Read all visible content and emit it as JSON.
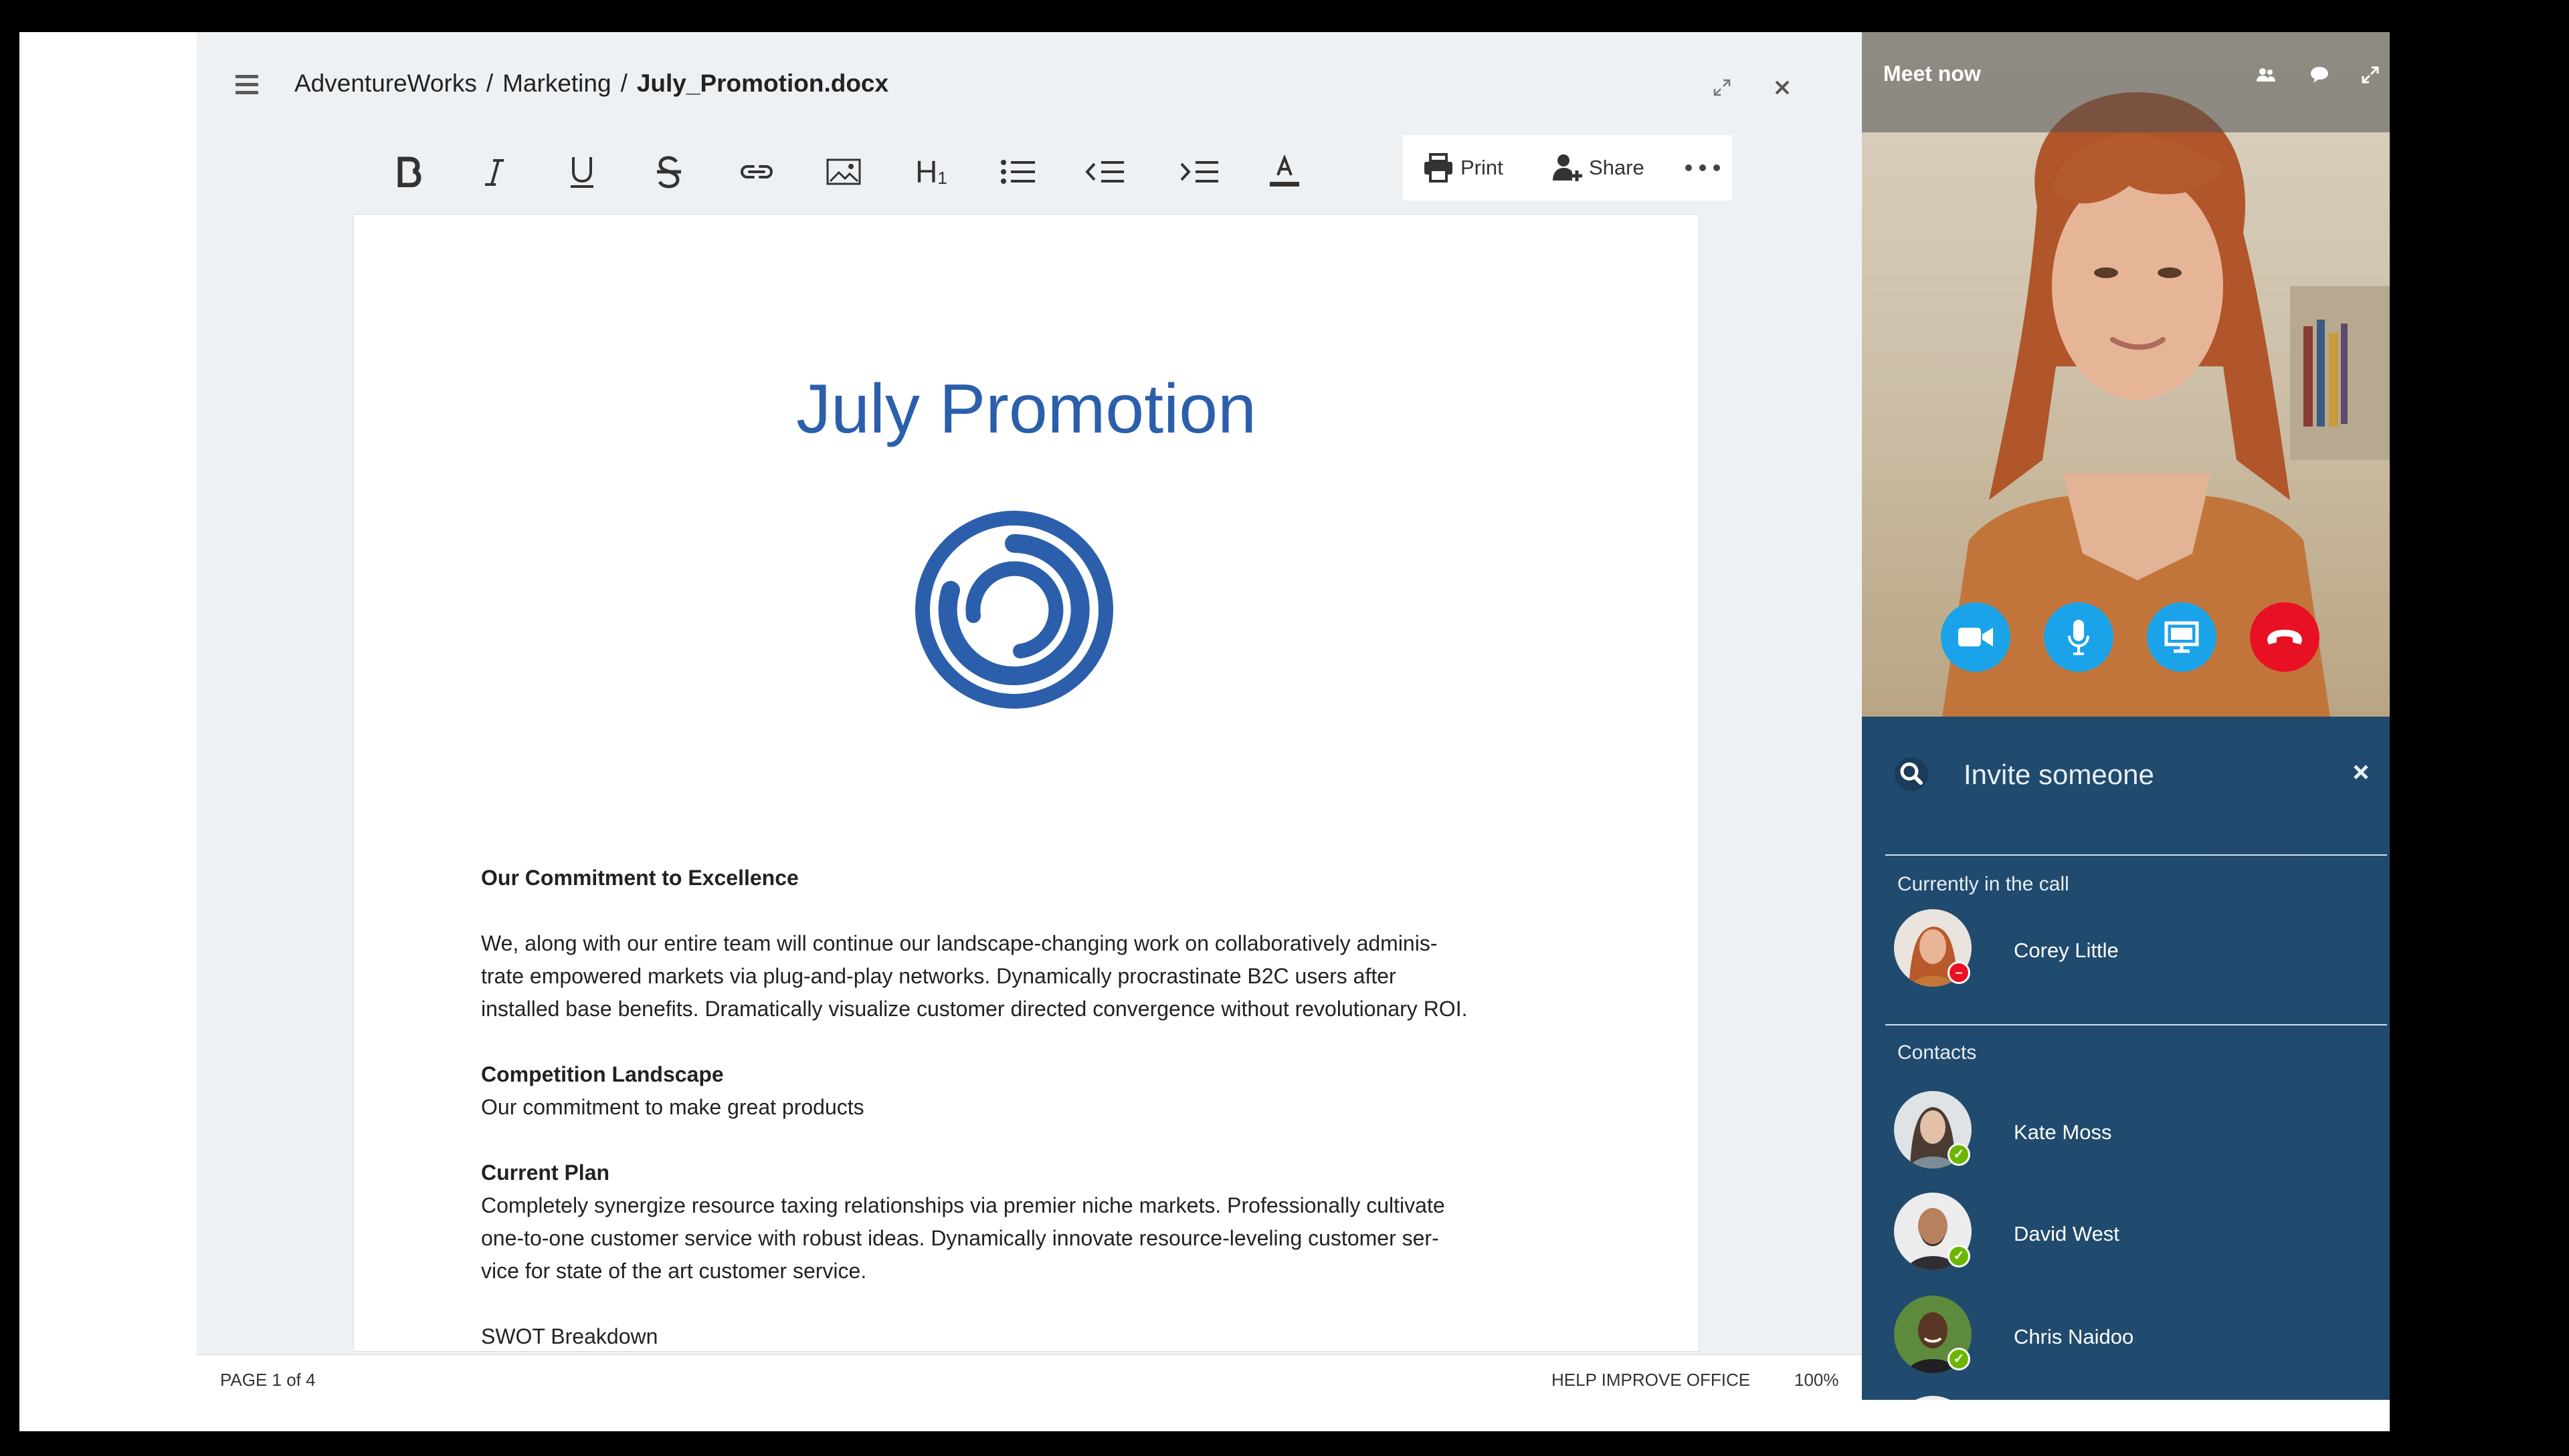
{
  "document": {
    "breadcrumb": {
      "root": "AdventureWorks",
      "folder": "Marketing",
      "file": "July_Promotion.docx",
      "separator": "/"
    },
    "toolbar": {
      "heading_label": "H",
      "heading_sub": "1",
      "print_label": "Print",
      "share_label": "Share"
    },
    "title": "July Promotion",
    "sections": {
      "commitment_heading": "Our Commitment to Excellence",
      "commitment_body_1": "We, along with our entire team will continue our landscape-changing work on collaboratively adminis-",
      "commitment_body_2": "trate empowered markets via plug-and-play networks. Dynamically procrastinate B2C users after",
      "commitment_body_3": "installed base benefits. Dramatically visualize customer directed convergence without revolutionary ROI.",
      "competition_heading": "Competition Landscape",
      "competition_body": "Our commitment to make great products",
      "plan_heading": "Current Plan",
      "plan_body_1": "Completely synergize resource taxing relationships via premier niche markets. Professionally cultivate",
      "plan_body_2": "one-to-one customer service with robust ideas. Dynamically innovate resource-leveling customer ser-",
      "plan_body_3": "vice for state of the art customer service.",
      "swot": "SWOT Breakdown"
    },
    "status": {
      "page": "PAGE 1 of 4",
      "help": "HELP IMPROVE OFFICE",
      "zoom": "100%"
    },
    "colors": {
      "title": "#2b5fab",
      "logo": "#2b5fab",
      "background": "#eef1f4"
    }
  },
  "meeting": {
    "title": "Meet now",
    "invite_placeholder": "Invite someone",
    "in_call_label": "Currently in the call",
    "in_call": [
      {
        "name": "Corey Little",
        "presence": "busy"
      }
    ],
    "contacts_label": "Contacts",
    "contacts": [
      {
        "name": "Kate Moss",
        "presence": "available"
      },
      {
        "name": "David West",
        "presence": "available"
      },
      {
        "name": "Chris Naidoo",
        "presence": "available"
      }
    ],
    "colors": {
      "call_button": "#1aa3e8",
      "hangup": "#e81123",
      "panel": "#204a6e"
    },
    "icons": [
      "people-icon",
      "chat-icon",
      "fullscreen-icon",
      "video-camera-icon",
      "microphone-icon",
      "screen-share-icon",
      "hang-up-icon",
      "search-icon",
      "close-icon"
    ]
  }
}
